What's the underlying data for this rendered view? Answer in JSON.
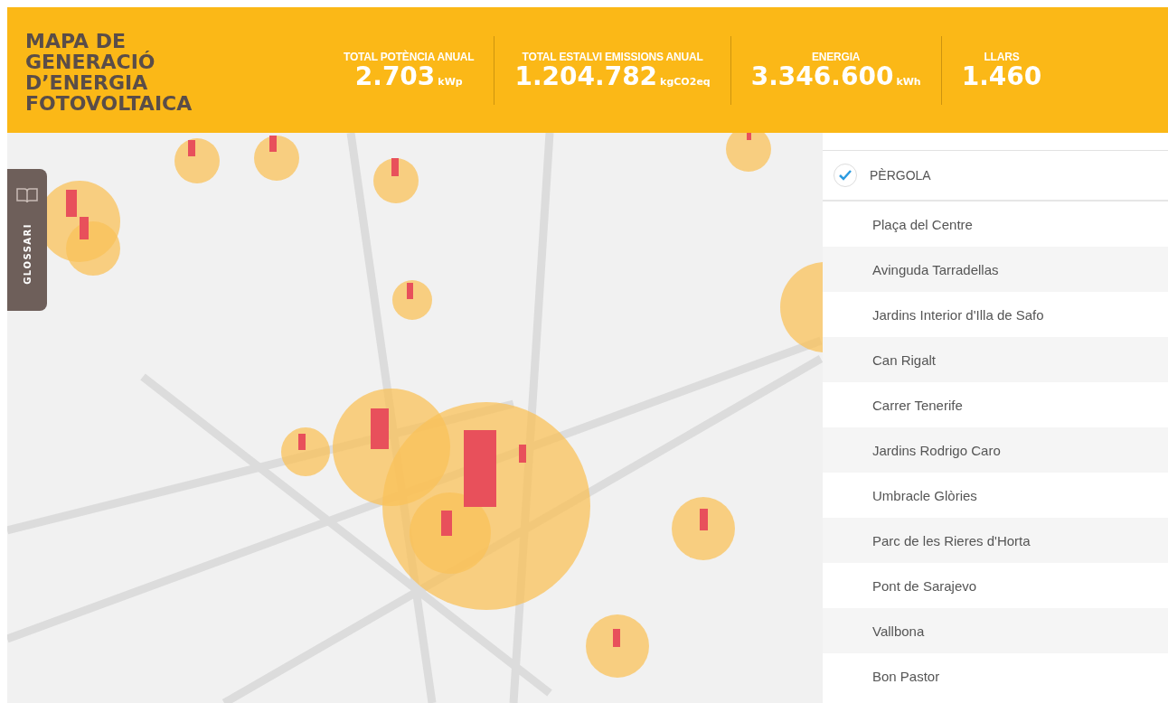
{
  "header": {
    "title": "MAPA DE GENERACIÓ D’ENERGIA FOTOVOLTAICA",
    "stats": [
      {
        "label": "TOTAL POTÈNCIA ANUAL",
        "value": "2.703",
        "unit": "kWp"
      },
      {
        "label": "TOTAL ESTALVI EMISSIONS ANUAL",
        "value": "1.204.782",
        "unit": "kgCO2eq"
      },
      {
        "label": "ENERGIA",
        "value": "3.346.600",
        "unit": "kWh"
      },
      {
        "label": "LLARS",
        "value": "1.460"
      }
    ]
  },
  "glossary_tab": {
    "label": "GLOSSARI"
  },
  "category_filter": {
    "label": "PÈRGOLA",
    "checked": true
  },
  "places": [
    "Plaça del Centre",
    "Avinguda Tarradellas",
    "Jardins Interior d'Illa de Safo",
    "Can Rigalt",
    "Carrer Tenerife",
    "Jardins Rodrigo Caro",
    "Umbracle Glòries",
    "Parc de les Rieres d'Horta",
    "Pont de Sarajevo",
    "Vallbona",
    "Bon Pastor"
  ]
}
